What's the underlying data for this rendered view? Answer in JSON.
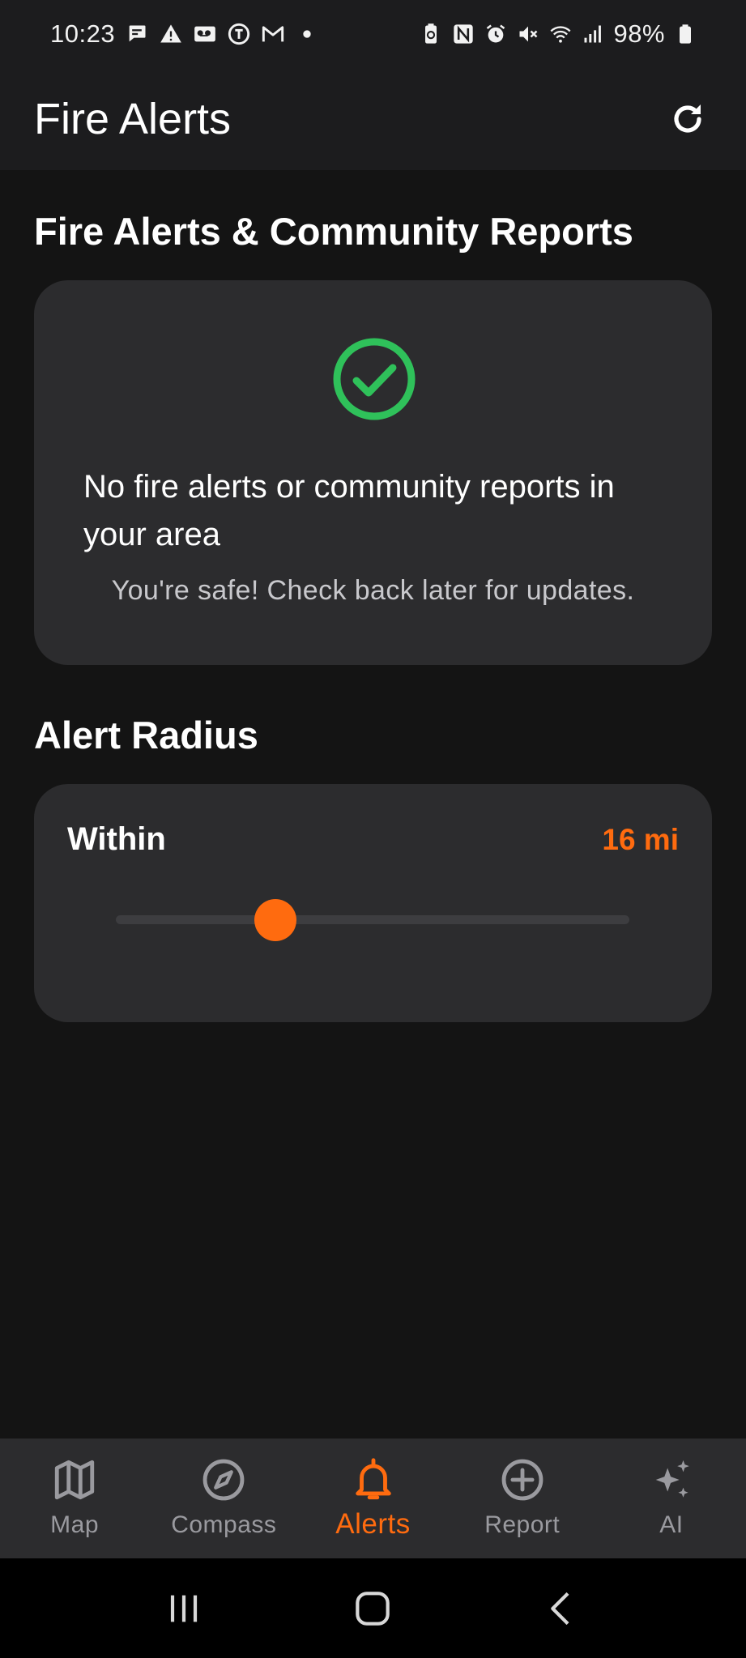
{
  "status_bar": {
    "time": "10:23",
    "battery": "98%",
    "left_icons": [
      "chat-icon",
      "warning-icon",
      "voicemail-icon",
      "nyt-icon",
      "gmail-icon",
      "dot-icon"
    ],
    "right_icons": [
      "battery-saver-icon",
      "nfc-icon",
      "alarm-icon",
      "mute-icon",
      "wifi-icon",
      "signal-icon",
      "battery-icon"
    ]
  },
  "app_bar": {
    "title": "Fire Alerts",
    "refresh_icon": "refresh-icon"
  },
  "alerts_section": {
    "title": "Fire Alerts & Community Reports",
    "empty_state": {
      "icon": "check-circle-icon",
      "title": "No fire alerts or community reports in your area",
      "subtitle": "You're safe! Check back later for updates."
    }
  },
  "radius_section": {
    "title": "Alert Radius",
    "label": "Within",
    "value_text": "16 mi",
    "slider_fraction": 0.31
  },
  "bottom_nav": {
    "items": [
      {
        "label": "Map",
        "icon": "map-icon",
        "active": false
      },
      {
        "label": "Compass",
        "icon": "compass-icon",
        "active": false
      },
      {
        "label": "Alerts",
        "icon": "bell-icon",
        "active": true
      },
      {
        "label": "Report",
        "icon": "add-circle-icon",
        "active": false
      },
      {
        "label": "AI",
        "icon": "sparkle-icon",
        "active": false
      }
    ]
  },
  "system_nav": {
    "buttons": [
      "recent-apps-icon",
      "home-icon",
      "back-icon"
    ]
  },
  "colors": {
    "accent": "#ff6b0f",
    "success": "#2fc15a",
    "background": "#141414",
    "card": "#2c2c2e",
    "app_bar": "#1c1c1e"
  }
}
